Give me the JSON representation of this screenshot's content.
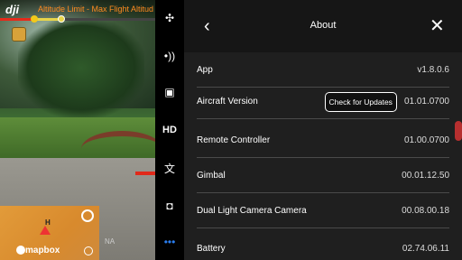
{
  "overlay": {
    "logo": "dji",
    "warning": "Altitude Limit - Max Flight Altitud",
    "flight_progress": 0.22,
    "map_brand": "mapbox",
    "home_marker": "H",
    "status_na": "NA"
  },
  "sidebar_icons": [
    {
      "name": "drone-icon",
      "glyph": "✣"
    },
    {
      "name": "signal-icon",
      "glyph": "•))"
    },
    {
      "name": "remote-controller-icon",
      "glyph": "▣"
    },
    {
      "name": "hd-icon",
      "glyph": "HD"
    },
    {
      "name": "language-icon",
      "glyph": "文"
    },
    {
      "name": "camera-icon",
      "glyph": "◘"
    },
    {
      "name": "more-icon",
      "glyph": "•••"
    }
  ],
  "panel": {
    "back_glyph": "‹",
    "title": "About",
    "close_glyph": "✕",
    "rows": [
      {
        "label": "App",
        "value": "v1.8.0.6"
      },
      {
        "label": "Aircraft Version",
        "value": "01.01.0700",
        "button": "Check for Updates"
      },
      {
        "label": "Remote Controller",
        "value": "01.00.0700"
      },
      {
        "label": "Gimbal",
        "value": "00.01.12.50"
      },
      {
        "label": "Dual Light Camera Camera",
        "value": "00.08.00.18"
      },
      {
        "label": "Battery",
        "value": "02.74.06.11"
      }
    ]
  },
  "colors": {
    "warning": "#ff8a1f",
    "panel_bg": "#1f1f1f",
    "active_icon": "#2a7ef0"
  }
}
